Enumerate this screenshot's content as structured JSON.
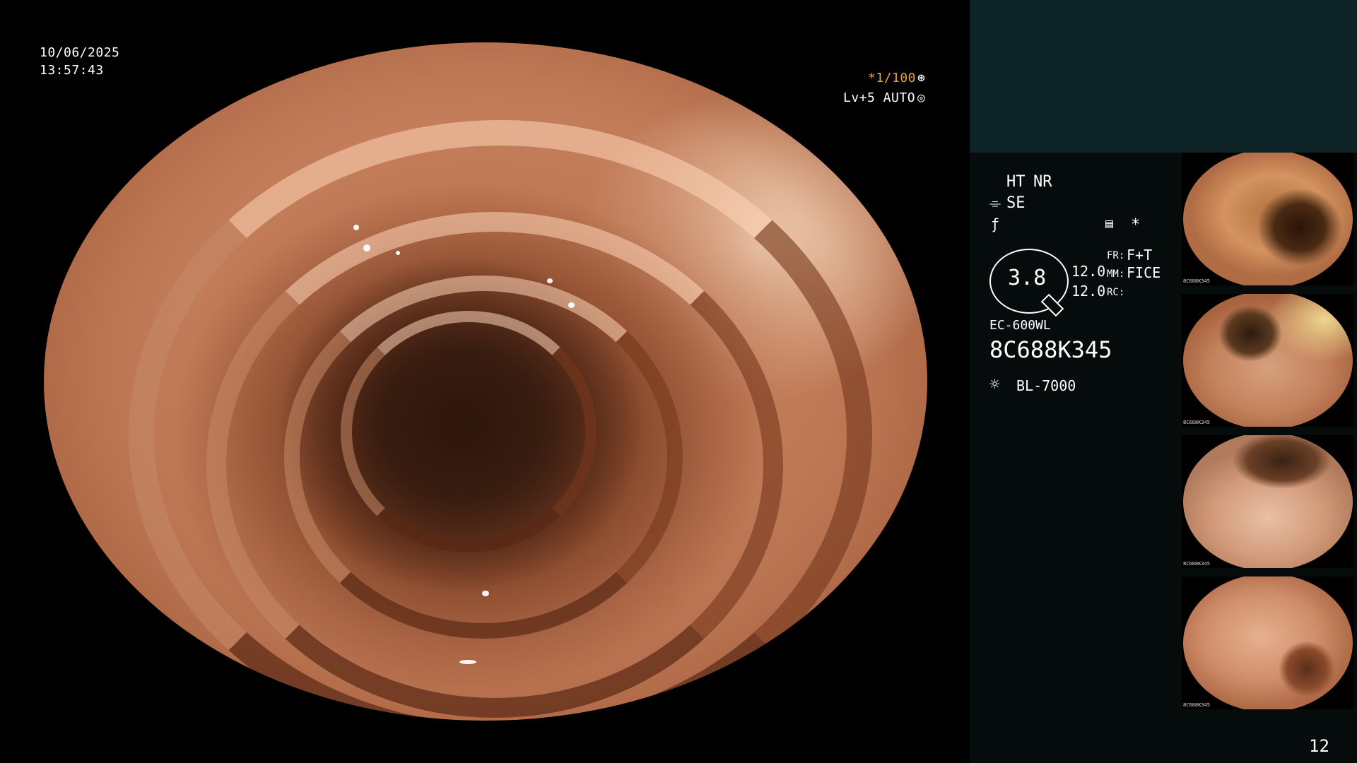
{
  "viewer": {
    "date": "10/06/2025",
    "time": "13:57:43",
    "shutter": "*1/100",
    "shutter_icon": "aperture-icon",
    "level": "Lv+5 AUTO",
    "auto_icon": "iris-icon"
  },
  "panel": {
    "ht": "HT",
    "nr": "NR",
    "se_icon": "sharpness-icon",
    "se": "SE",
    "gamma_icon": "gamma-icon",
    "menu_icon": "settings-card-icon",
    "star": "*",
    "zoom_value": "3.8",
    "row1_value": "12.0",
    "row2_value": "12.0",
    "fr_label": "FR:",
    "fr_value": "F+T",
    "mm_label": "MM:",
    "mm_value": "FICE",
    "rc_label": "RC:",
    "scope_model": "EC-600WL",
    "serial": "8C688K345",
    "light_icon": "light-source-icon",
    "light_source": "BL-7000",
    "page_number": "12"
  },
  "thumbnails": [
    {
      "caption": "8C688K345"
    },
    {
      "caption": "8C688K345"
    },
    {
      "caption": "8C688K345"
    },
    {
      "caption": "8C688K345"
    }
  ],
  "colors": {
    "accent_orange": "#f0a030",
    "panel_top": "#0d2325",
    "panel_body": "#060b0c"
  }
}
